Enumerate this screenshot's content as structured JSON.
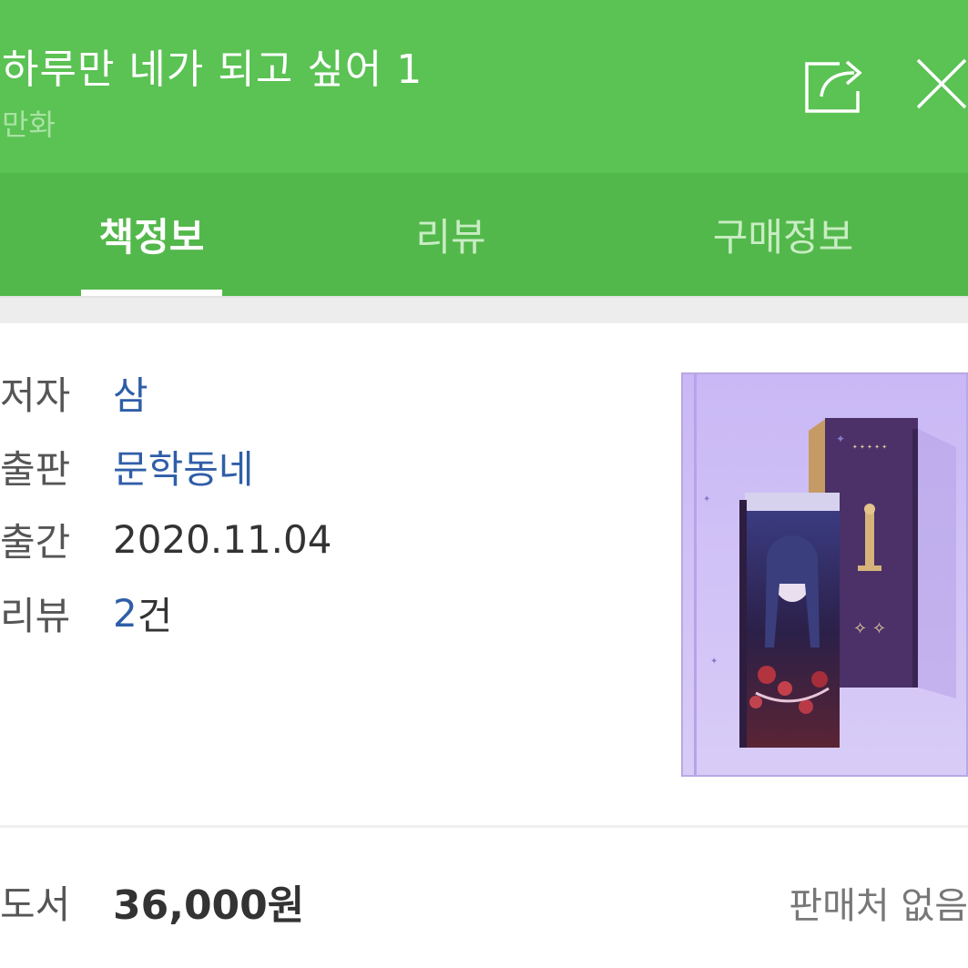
{
  "header": {
    "title": "하루만 네가 되고 싶어 1",
    "category": "만화",
    "background_color": "#5bc254",
    "share_icon": "share-icon",
    "close_icon": "close-icon"
  },
  "tabs": [
    {
      "label": "책정보",
      "active": true
    },
    {
      "label": "리뷰",
      "active": false
    },
    {
      "label": "구매정보",
      "active": false
    }
  ],
  "info": {
    "author_label": "저자",
    "author_value": "삼",
    "publisher_label": "출판",
    "publisher_value": "문학동네",
    "date_label": "출간",
    "date_value": "2020.11.04",
    "review_label": "리뷰",
    "review_count": "2",
    "review_unit": "건",
    "link_color": "#2f5ea8"
  },
  "cover": {
    "kind": "book-cover-image"
  },
  "price": {
    "label": "도서",
    "value": "36,000원",
    "seller_status": "판매처 없음"
  }
}
